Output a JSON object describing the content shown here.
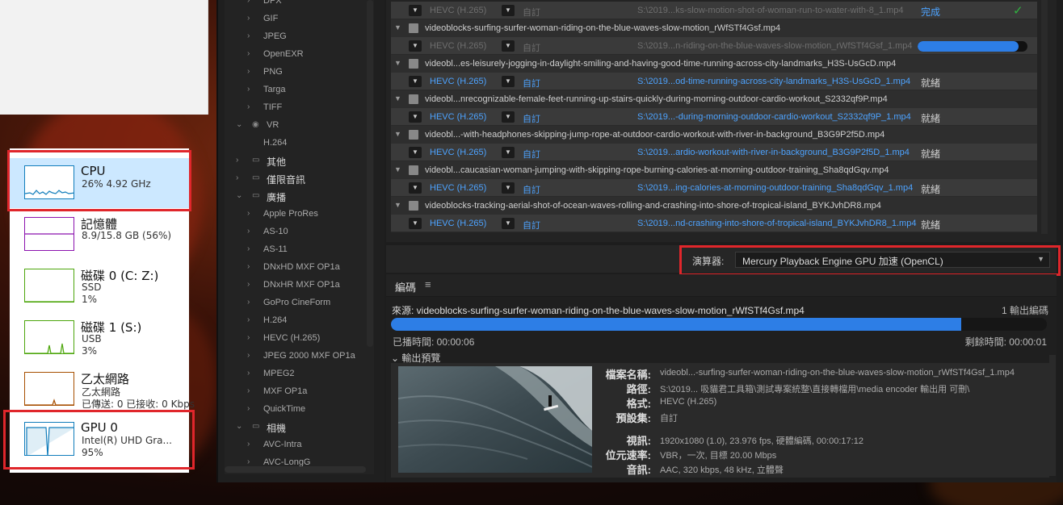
{
  "task_manager": {
    "items": [
      {
        "title": "CPU",
        "sub1": "26%  4.92 GHz",
        "sub2": "",
        "sub3": "",
        "graph_color": "#117dbb",
        "usage": 0.26
      },
      {
        "title": "記憶體",
        "sub1": "8.9/15.8 GB (56%)",
        "sub2": "",
        "sub3": "",
        "graph_color": "#8b12ae",
        "usage": 0.56
      },
      {
        "title": "磁碟 0 (C: Z:)",
        "sub1": "SSD",
        "sub2": "1%",
        "sub3": "",
        "graph_color": "#4da60c",
        "usage": 0.01
      },
      {
        "title": "磁碟 1 (S:)",
        "sub1": "USB",
        "sub2": "3%",
        "sub3": "",
        "graph_color": "#4da60c",
        "usage": 0.03
      },
      {
        "title": "乙太網路",
        "sub1": "乙太網路",
        "sub2": "已傳送: 0  已接收: 0 Kbps",
        "sub3": "",
        "graph_color": "#a74f01",
        "usage": 0.0
      },
      {
        "title": "GPU 0",
        "sub1": "Intel(R) UHD Gra...",
        "sub2": "95%",
        "sub3": "",
        "graph_color": "#117dbb",
        "usage": 0.95
      }
    ]
  },
  "preset_browser": {
    "rows": [
      {
        "type": "item",
        "label": "DPX",
        "indent": 2
      },
      {
        "type": "item",
        "label": "GIF",
        "indent": 2
      },
      {
        "type": "item",
        "label": "JPEG",
        "indent": 2
      },
      {
        "type": "item",
        "label": "OpenEXR",
        "indent": 2
      },
      {
        "type": "item",
        "label": "PNG",
        "indent": 2
      },
      {
        "type": "item",
        "label": "Targa",
        "indent": 2
      },
      {
        "type": "item",
        "label": "TIFF",
        "indent": 2
      },
      {
        "type": "group",
        "label": "VR",
        "indent": 1,
        "open": true
      },
      {
        "type": "leaf",
        "label": "H.264",
        "indent": 2
      },
      {
        "type": "cat",
        "label": "其他",
        "indent": 0,
        "open": false
      },
      {
        "type": "cat",
        "label": "僅限音訊",
        "indent": 0,
        "open": false
      },
      {
        "type": "cat",
        "label": "廣播",
        "indent": 0,
        "open": true
      },
      {
        "type": "item",
        "label": "Apple ProRes",
        "indent": 2
      },
      {
        "type": "item",
        "label": "AS-10",
        "indent": 2
      },
      {
        "type": "item",
        "label": "AS-11",
        "indent": 2
      },
      {
        "type": "item",
        "label": "DNxHD MXF OP1a",
        "indent": 2
      },
      {
        "type": "item",
        "label": "DNxHR MXF OP1a",
        "indent": 2
      },
      {
        "type": "item",
        "label": "GoPro CineForm",
        "indent": 2
      },
      {
        "type": "item",
        "label": "H.264",
        "indent": 2
      },
      {
        "type": "item",
        "label": "HEVC (H.265)",
        "indent": 2
      },
      {
        "type": "item",
        "label": "JPEG 2000 MXF OP1a",
        "indent": 2
      },
      {
        "type": "item",
        "label": "MPEG2",
        "indent": 2
      },
      {
        "type": "item",
        "label": "MXF OP1a",
        "indent": 2
      },
      {
        "type": "item",
        "label": "QuickTime",
        "indent": 2
      },
      {
        "type": "cat",
        "label": "相機",
        "indent": 0,
        "open": true
      },
      {
        "type": "item",
        "label": "AVC-Intra",
        "indent": 2
      },
      {
        "type": "item",
        "label": "AVC-LongG",
        "indent": 2
      }
    ]
  },
  "queue": {
    "rows": [
      {
        "kind": "child",
        "dim": true,
        "format": "HEVC (H.265)",
        "preset": "自訂",
        "output": "S:\\2019...ks-slow-motion-shot-of-woman-run-to-water-with-8_1.mp4",
        "status": "完成",
        "done": true
      },
      {
        "kind": "parent",
        "name": "videoblocks-surfing-surfer-woman-riding-on-the-blue-waves-slow-motion_rWfSTf4Gsf.mp4"
      },
      {
        "kind": "child",
        "dim": true,
        "format": "HEVC (H.265)",
        "preset": "自訂",
        "output": "S:\\2019...n-riding-on-the-blue-waves-slow-motion_rWfSTf4Gsf_1.mp4",
        "progress": 0.92
      },
      {
        "kind": "parent",
        "name": "videobl...es-leisurely-jogging-in-daylight-smiling-and-having-good-time-running-across-city-landmarks_H3S-UsGcD.mp4"
      },
      {
        "kind": "child",
        "format": "HEVC (H.265)",
        "preset": "自訂",
        "output": "S:\\2019...od-time-running-across-city-landmarks_H3S-UsGcD_1.mp4",
        "status": "就緒"
      },
      {
        "kind": "parent",
        "name": "videobl...nrecognizable-female-feet-running-up-stairs-quickly-during-morning-outdoor-cardio-workout_S2332qf9P.mp4"
      },
      {
        "kind": "child",
        "format": "HEVC (H.265)",
        "preset": "自訂",
        "output": "S:\\2019...-during-morning-outdoor-cardio-workout_S2332qf9P_1.mp4",
        "status": "就緒"
      },
      {
        "kind": "parent",
        "name": "videobl...-with-headphones-skipping-jump-rope-at-outdoor-cardio-workout-with-river-in-background_B3G9P2f5D.mp4"
      },
      {
        "kind": "child",
        "format": "HEVC (H.265)",
        "preset": "自訂",
        "output": "S:\\2019...ardio-workout-with-river-in-background_B3G9P2f5D_1.mp4",
        "status": "就緒"
      },
      {
        "kind": "parent",
        "name": "videobl...caucasian-woman-jumping-with-skipping-rope-burning-calories-at-morning-outdoor-training_Sha8qdGqv.mp4"
      },
      {
        "kind": "child",
        "format": "HEVC (H.265)",
        "preset": "自訂",
        "output": "S:\\2019...ing-calories-at-morning-outdoor-training_Sha8qdGqv_1.mp4",
        "status": "就緒"
      },
      {
        "kind": "parent",
        "name": "videoblocks-tracking-aerial-shot-of-ocean-waves-rolling-and-crashing-into-shore-of-tropical-island_BYKJvhDR8.mp4"
      },
      {
        "kind": "child",
        "format": "HEVC (H.265)",
        "preset": "自訂",
        "output": "S:\\2019...nd-crashing-into-shore-of-tropical-island_BYKJvhDR8_1.mp4",
        "status": "就緒"
      }
    ]
  },
  "renderer": {
    "label": "演算器:",
    "value": "Mercury Playback Engine GPU 加速 (OpenCL)"
  },
  "encoding": {
    "title": "編碼",
    "menu_icon": "hamburger-menu-icon",
    "source_label": "來源: videoblocks-surfing-surfer-woman-riding-on-the-blue-waves-slow-motion_rWfSTf4Gsf.mp4",
    "output_count": "1 輸出編碼",
    "progress": 0.87,
    "elapsed": "已播時間: 00:00:06",
    "remaining": "剩餘時間: 00:00:01",
    "preview_header": "輸出預覽",
    "info": [
      {
        "k": "檔案名稱:",
        "v": "videobl...-surfing-surfer-woman-riding-on-the-blue-waves-slow-motion_rWfSTf4Gsf_1.mp4"
      },
      {
        "k": "路徑:",
        "v": "S:\\2019... 吸貓君工具箱\\測試專案統整\\直接轉檔用\\media  encoder 輸出用 可刪\\"
      },
      {
        "k": "格式:",
        "v": "HEVC (H.265)"
      },
      {
        "k": "預設集:",
        "v": "自訂"
      },
      {
        "k": "視訊:",
        "v": "1920x1080 (1.0), 23.976 fps, 硬體編碼, 00:00:17:12"
      },
      {
        "k": "位元速率:",
        "v": "VBR，一次, 目標 20.00 Mbps"
      },
      {
        "k": "音訊:",
        "v": "AAC, 320 kbps, 48 kHz, 立體聲"
      }
    ]
  }
}
